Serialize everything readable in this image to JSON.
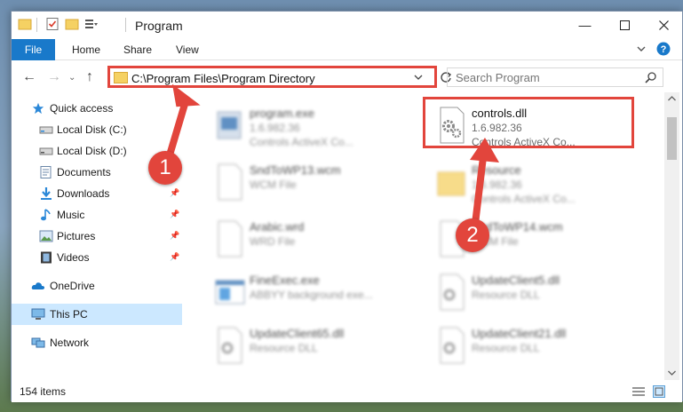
{
  "window": {
    "title": "Program"
  },
  "ribbon": {
    "tabs": [
      "File",
      "Home",
      "Share",
      "View"
    ]
  },
  "navbar": {
    "address": "C:\\Program Files\\Program Directory",
    "search_placeholder": "Search Program"
  },
  "sidebar": {
    "items": [
      {
        "label": "Quick access",
        "icon": "star-icon",
        "pinned": false
      },
      {
        "label": "Local Disk (C:)",
        "icon": "drive-icon",
        "pinned": false
      },
      {
        "label": "Local Disk (D:)",
        "icon": "drive-icon",
        "pinned": false
      },
      {
        "label": "Documents",
        "icon": "documents-icon",
        "pinned": false
      },
      {
        "label": "Downloads",
        "icon": "download-icon",
        "pinned": true
      },
      {
        "label": "Music",
        "icon": "music-icon",
        "pinned": true
      },
      {
        "label": "Pictures",
        "icon": "pictures-icon",
        "pinned": true
      },
      {
        "label": "Videos",
        "icon": "videos-icon",
        "pinned": true
      },
      {
        "label": "OneDrive",
        "icon": "cloud-icon",
        "pinned": false
      },
      {
        "label": "This PC",
        "icon": "computer-icon",
        "pinned": false,
        "selected": true
      },
      {
        "label": "Network",
        "icon": "network-icon",
        "pinned": false
      }
    ]
  },
  "files": [
    {
      "name": "program.exe",
      "version": "1.6.982.36",
      "desc": "Controls ActiveX Co...",
      "icon": "exe-icon",
      "blurred": true
    },
    {
      "name": "controls.dll",
      "version": "1.6.982.36",
      "desc": "Controls ActiveX Co...",
      "icon": "dll-gear-icon",
      "blurred": false
    },
    {
      "name": "SndToWP13.wcm",
      "version": "WCM File",
      "desc": "",
      "icon": "blank-file-icon",
      "blurred": true
    },
    {
      "name": "Resource",
      "version": "1.6.982.36",
      "desc": "Controls ActiveX Co...",
      "icon": "folder-file-icon",
      "blurred": true
    },
    {
      "name": "Arabic.wrd",
      "version": "WRD File",
      "desc": "",
      "icon": "blank-file-icon",
      "blurred": true
    },
    {
      "name": "SndToWP14.wcm",
      "version": "WCM File",
      "desc": "",
      "icon": "blank-file-icon",
      "blurred": true
    },
    {
      "name": "FineExec.exe",
      "version": "ABBYY background exe...",
      "desc": "",
      "icon": "app-window-icon",
      "blurred": true
    },
    {
      "name": "UpdateClient5.dll",
      "version": "Resource DLL",
      "desc": "",
      "icon": "dll-gear-icon",
      "blurred": true
    },
    {
      "name": "UpdateClient65.dll",
      "version": "Resource DLL",
      "desc": "",
      "icon": "dll-gear-icon",
      "blurred": true
    },
    {
      "name": "UpdateClient21.dll",
      "version": "Resource DLL",
      "desc": "",
      "icon": "dll-gear-icon",
      "blurred": true
    }
  ],
  "status": {
    "count": "154 items"
  },
  "callouts": [
    "1",
    "2"
  ],
  "colors": {
    "accent": "#1979ca",
    "callout": "#e2453c",
    "selected": "#cce8ff"
  }
}
